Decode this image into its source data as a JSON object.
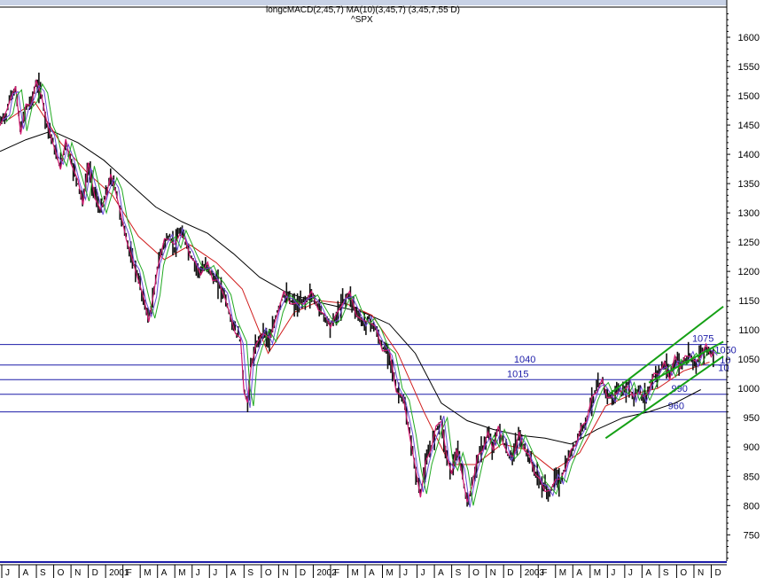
{
  "chart_data": {
    "type": "line",
    "symbol": "^SPX",
    "header_text": "longcMACD(2,45,7) MA(10)(3,45,7) (3,45,7,55 D)",
    "ylim": [
      705,
      1650
    ],
    "yticks": [
      750,
      800,
      850,
      900,
      950,
      1000,
      1050,
      1100,
      1150,
      1200,
      1250,
      1300,
      1350,
      1400,
      1450,
      1500,
      1550,
      1600
    ],
    "x_range": [
      0,
      42
    ],
    "x_ticks": [
      {
        "x": 0,
        "label": "J"
      },
      {
        "x": 1,
        "label": "A"
      },
      {
        "x": 2,
        "label": "S"
      },
      {
        "x": 3,
        "label": "O"
      },
      {
        "x": 4,
        "label": "N"
      },
      {
        "x": 5,
        "label": "D"
      },
      {
        "x": 6,
        "label": "2001"
      },
      {
        "x": 7,
        "label": "F"
      },
      {
        "x": 8,
        "label": "M"
      },
      {
        "x": 9,
        "label": "A"
      },
      {
        "x": 10,
        "label": "M"
      },
      {
        "x": 11,
        "label": "J"
      },
      {
        "x": 12,
        "label": "J"
      },
      {
        "x": 13,
        "label": "A"
      },
      {
        "x": 14,
        "label": "S"
      },
      {
        "x": 15,
        "label": "O"
      },
      {
        "x": 16,
        "label": "N"
      },
      {
        "x": 17,
        "label": "D"
      },
      {
        "x": 18,
        "label": "2002"
      },
      {
        "x": 19,
        "label": "F"
      },
      {
        "x": 20,
        "label": "M"
      },
      {
        "x": 21,
        "label": "A"
      },
      {
        "x": 22,
        "label": "M"
      },
      {
        "x": 23,
        "label": "J"
      },
      {
        "x": 24,
        "label": "J"
      },
      {
        "x": 25,
        "label": "A"
      },
      {
        "x": 26,
        "label": "S"
      },
      {
        "x": 27,
        "label": "O"
      },
      {
        "x": 28,
        "label": "N"
      },
      {
        "x": 29,
        "label": "D"
      },
      {
        "x": 30,
        "label": "2003"
      },
      {
        "x": 31,
        "label": "F"
      },
      {
        "x": 32,
        "label": "M"
      },
      {
        "x": 33,
        "label": "A"
      },
      {
        "x": 34,
        "label": "M"
      },
      {
        "x": 35,
        "label": "J"
      },
      {
        "x": 36,
        "label": "J"
      },
      {
        "x": 37,
        "label": "A"
      },
      {
        "x": 38,
        "label": "S"
      },
      {
        "x": 39,
        "label": "O"
      },
      {
        "x": 40,
        "label": "N"
      },
      {
        "x": 41,
        "label": "D"
      }
    ],
    "price": {
      "x": [
        0,
        0.4,
        0.6,
        0.9,
        1.2,
        1.5,
        1.8,
        2.1,
        2.4,
        2.7,
        3.0,
        3.2,
        3.5,
        3.8,
        4.1,
        4.5,
        4.8,
        5.1,
        5.5,
        5.8,
        6.1,
        6.4,
        6.7,
        7.0,
        7.3,
        7.6,
        7.9,
        8.3,
        8.6,
        8.9,
        9.1,
        9.5,
        9.8,
        10.1,
        10.4,
        10.7,
        11.0,
        11.3,
        11.6,
        12.0,
        12.3,
        12.6,
        13.0,
        13.3,
        13.6,
        13.9,
        14.1,
        14.3,
        14.5,
        14.8,
        15.2,
        15.6,
        16.0,
        16.4,
        16.8,
        17.2,
        17.6,
        18.0,
        18.4,
        18.8,
        19.1,
        19.4,
        19.8,
        20.2,
        20.6,
        21.0,
        21.3,
        21.7,
        22.1,
        22.5,
        22.9,
        23.3,
        23.7,
        24.0,
        24.3,
        24.6,
        24.9,
        25.2,
        25.5,
        25.8,
        26.1,
        26.4,
        26.7,
        27.0,
        27.3,
        27.6,
        27.9,
        28.2,
        28.5,
        28.8,
        29.1,
        29.4,
        29.7,
        30.0,
        30.3,
        30.6,
        30.9,
        31.2,
        31.5,
        31.8,
        32.1,
        32.4,
        32.7,
        33.0,
        33.3,
        33.6,
        33.9,
        34.2,
        34.5,
        34.8,
        35.1,
        35.4,
        35.7,
        36.0,
        36.3,
        36.6,
        36.9,
        37.2,
        37.5,
        37.8,
        38.1,
        38.4,
        38.7,
        39.0,
        39.3,
        39.6,
        39.9,
        40.2,
        40.5,
        40.8,
        41.1,
        41.3
      ],
      "y": [
        1455,
        1470,
        1500,
        1510,
        1440,
        1480,
        1490,
        1520,
        1505,
        1450,
        1430,
        1400,
        1380,
        1420,
        1390,
        1350,
        1320,
        1380,
        1330,
        1300,
        1330,
        1360,
        1340,
        1290,
        1260,
        1220,
        1200,
        1150,
        1120,
        1160,
        1210,
        1250,
        1260,
        1240,
        1270,
        1250,
        1230,
        1210,
        1200,
        1210,
        1190,
        1180,
        1160,
        1120,
        1100,
        1080,
        1000,
        970,
        1040,
        1070,
        1100,
        1080,
        1130,
        1160,
        1150,
        1140,
        1150,
        1160,
        1140,
        1120,
        1110,
        1120,
        1150,
        1160,
        1130,
        1110,
        1120,
        1100,
        1070,
        1060,
        1000,
        980,
        920,
        860,
        820,
        870,
        900,
        930,
        950,
        880,
        860,
        890,
        860,
        800,
        840,
        880,
        900,
        920,
        900,
        930,
        910,
        880,
        890,
        920,
        900,
        880,
        860,
        840,
        830,
        820,
        850,
        840,
        870,
        890,
        910,
        930,
        950,
        980,
        1000,
        1010,
        990,
        980,
        1000,
        990,
        1010,
        980,
        1000,
        980,
        1000,
        1020,
        1030,
        1040,
        1020,
        1050,
        1040,
        1050,
        1060,
        1040,
        1060,
        1070,
        1060,
        1060
      ]
    },
    "ma_red": {
      "x": [
        0.5,
        2,
        3.5,
        5,
        6.5,
        8,
        9.5,
        11,
        12.5,
        14,
        15.5,
        17,
        18.5,
        20,
        21.5,
        23,
        24.5,
        26,
        27.5,
        29,
        30.5,
        32,
        33.5,
        35,
        36.5,
        38,
        39.5,
        41
      ],
      "y": [
        1460,
        1490,
        1420,
        1370,
        1330,
        1260,
        1220,
        1245,
        1215,
        1170,
        1060,
        1130,
        1150,
        1145,
        1125,
        1060,
        960,
        870,
        870,
        905,
        895,
        860,
        890,
        970,
        990,
        1000,
        1030,
        1045
      ]
    },
    "ma_black": {
      "x": [
        0,
        1.5,
        3,
        4.5,
        6,
        7.5,
        9,
        10.5,
        12,
        13.5,
        15,
        16.5,
        18,
        19.5,
        21,
        22.5,
        24,
        25.5,
        27,
        28.5,
        30,
        31.5,
        33,
        34.5,
        36,
        37.5,
        39,
        40.5
      ],
      "y": [
        1405,
        1425,
        1440,
        1420,
        1390,
        1350,
        1310,
        1285,
        1265,
        1230,
        1190,
        1165,
        1150,
        1140,
        1130,
        1110,
        1060,
        975,
        945,
        930,
        920,
        915,
        905,
        930,
        950,
        960,
        975,
        998
      ]
    },
    "trendlines": [
      {
        "x1": 35.2,
        "y1": 990,
        "x2": 41.8,
        "y2": 1140
      },
      {
        "x1": 37.5,
        "y1": 1010,
        "x2": 41.8,
        "y2": 1080
      },
      {
        "x1": 35.0,
        "y1": 915,
        "x2": 41.8,
        "y2": 1055
      }
    ],
    "levels": [
      {
        "value": 1075,
        "label": "1075",
        "label_x": 40.0
      },
      {
        "value": 1040,
        "label": "1040",
        "label_x": 29.7
      },
      {
        "value": 1015,
        "label": "1015",
        "label_x": 29.3
      },
      {
        "value": 990,
        "label": "990",
        "label_x": 38.8
      },
      {
        "value": 960,
        "label": "960",
        "label_x": 38.6
      }
    ],
    "extra_labels": [
      {
        "x": 41.3,
        "value": 1060,
        "label": "1050"
      },
      {
        "x": 41.6,
        "value": 1043,
        "label": "10"
      },
      {
        "x": 41.5,
        "value": 1030,
        "label": "10"
      }
    ],
    "colors": {
      "price": "#111111",
      "price_overlay": "#d0186e",
      "ma_fast": "#22aa22",
      "ma_red": "#d01c1c",
      "ma_black": "#000000",
      "level": "#1c1ca8",
      "trend": "#15a015"
    }
  }
}
